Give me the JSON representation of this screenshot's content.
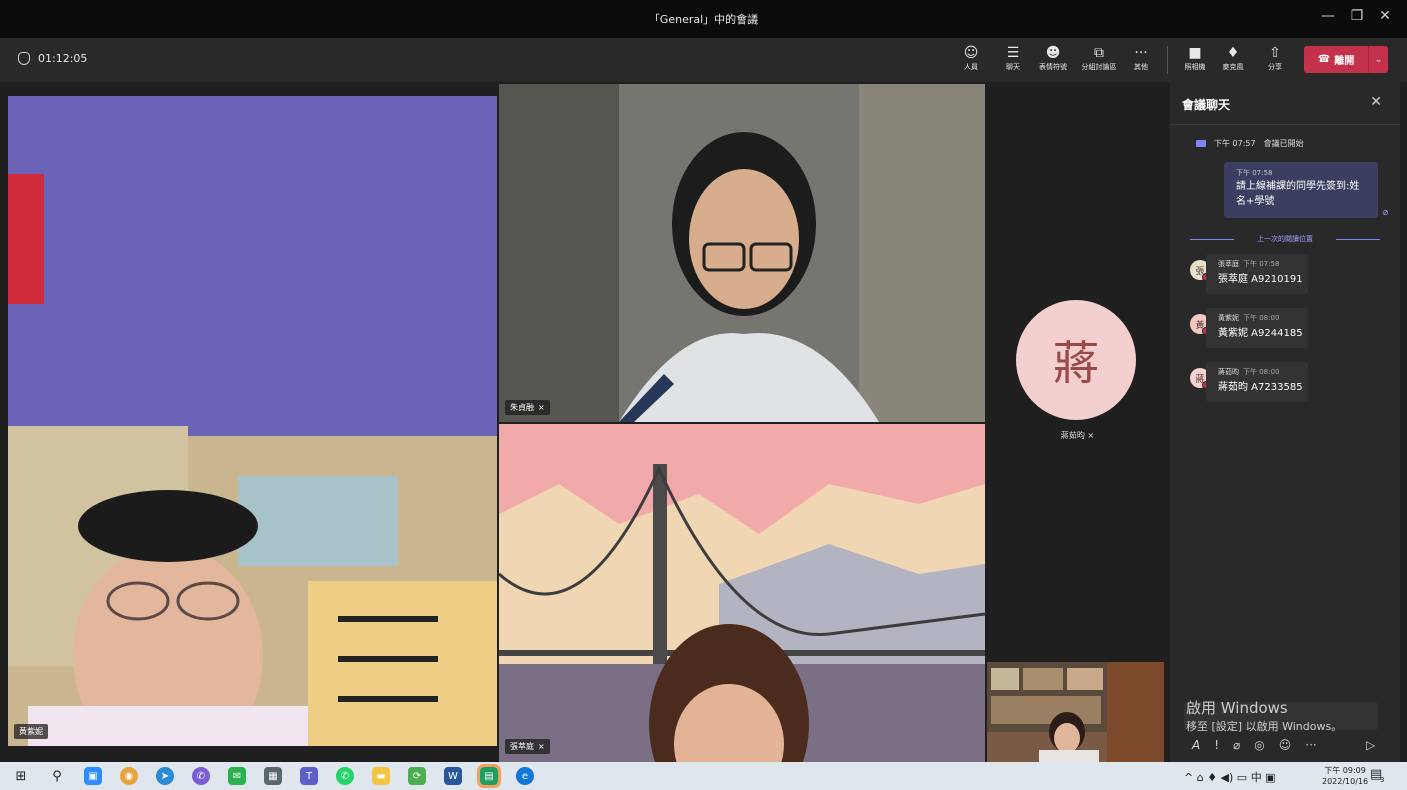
{
  "window": {
    "title": "「General」中的會議",
    "minimize": "—",
    "restore": "❐",
    "close": "✕"
  },
  "toolbar": {
    "timer": "01:12:05",
    "buttons": [
      {
        "label": "人員",
        "icon": "people-icon",
        "glyph": "☺"
      },
      {
        "label": "聊天",
        "icon": "chat-icon",
        "glyph": "☰"
      },
      {
        "label": "表情符號",
        "icon": "emoji-icon",
        "glyph": "☻"
      },
      {
        "label": "分組討論區",
        "icon": "breakout-icon",
        "glyph": "⧉"
      },
      {
        "label": "其他",
        "icon": "more-icon",
        "glyph": "···"
      },
      {
        "label": "照相機",
        "icon": "camera-icon",
        "glyph": "■"
      },
      {
        "label": "麥克風",
        "icon": "microphone-icon",
        "glyph": "♦"
      },
      {
        "label": "分享",
        "icon": "share-icon",
        "glyph": "⇧"
      }
    ],
    "leave": {
      "label": "離開",
      "icon": "phone-hangup-icon",
      "glyph": "☎",
      "caret": "⌄"
    }
  },
  "participants": {
    "main": {
      "name": "黃紫妮"
    },
    "top_center": {
      "name": "朱貞融"
    },
    "bottom_center": {
      "name": "張萃庭"
    },
    "avatar": {
      "name": "蔣茹昀",
      "initial": "蔣",
      "color": "#f3cfcf"
    }
  },
  "chat": {
    "title": "會議聊天",
    "close": "✕",
    "system": {
      "time": "下午 07:57",
      "text": "會議已開始"
    },
    "my_message": {
      "time": "下午 07:58",
      "text_line1": "請上線補課的同學先簽到:姓",
      "text_line2": "名+學號"
    },
    "read_marker": "上一次的閱讀位置",
    "messages": [
      {
        "initial": "張",
        "name": "張萃庭",
        "time": "下午 07:58",
        "text": "張萃庭 A9210191",
        "avatar_color": "#e8e3cc"
      },
      {
        "initial": "黃",
        "name": "黃紫妮",
        "time": "下午 08:00",
        "text": "黃紫妮 A9244185",
        "avatar_color": "#f4c9c0"
      },
      {
        "initial": "蔣",
        "name": "蔣茹昀",
        "time": "下午 08:00",
        "text": "蔣茹昀 A7233585",
        "avatar_color": "#f6d2d2"
      }
    ],
    "format_icons": [
      "𝘈",
      "!",
      "⌀",
      "◎",
      "☺",
      "···"
    ],
    "send": "▷"
  },
  "watermark": {
    "line1": "啟用 Windows",
    "line2": "移至 [設定] 以啟用 Windows。"
  },
  "taskbar": {
    "clock_time": "下午 09:09",
    "clock_date": "2022/10/16",
    "tray": "^ ⌂ ♦ ◀) ▭ 中 ▣",
    "notification_count": "3"
  }
}
